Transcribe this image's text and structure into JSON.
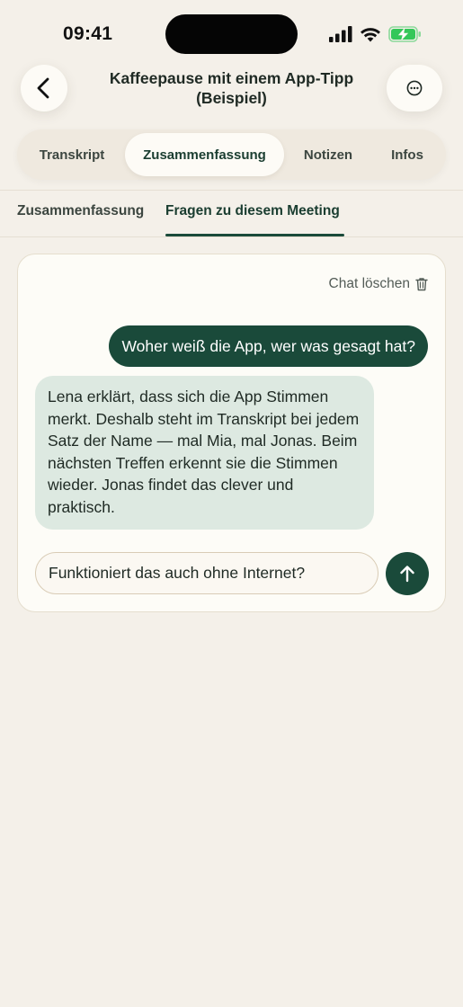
{
  "status_bar": {
    "time": "09:41"
  },
  "header": {
    "title": "Kaffeepause mit einem App-Tipp (Beispiel)"
  },
  "main_tabs": [
    {
      "label": "Transkript",
      "active": false
    },
    {
      "label": "Zusammenfassung",
      "active": true
    },
    {
      "label": "Notizen",
      "active": false
    },
    {
      "label": "Infos",
      "active": false
    }
  ],
  "sub_tabs": [
    {
      "label": "Zusammenfassung",
      "active": false
    },
    {
      "label": "Fragen zu diesem Meeting",
      "active": true
    }
  ],
  "chat": {
    "clear_label": "Chat löschen",
    "messages": [
      {
        "role": "user",
        "text": "Woher weiß die App, wer was gesagt hat?"
      },
      {
        "role": "assistant",
        "text": "Lena erklärt, dass sich die App Stimmen merkt. Deshalb steht im Transkript bei jedem Satz der Name — mal Mia, mal Jonas. Beim nächsten Treffen erkennt sie die Stimmen wieder. Jonas findet das clever und praktisch."
      }
    ],
    "input_value": "Funktioniert das auch ohne Internet?"
  },
  "icons": {
    "back": "chevron-left-icon",
    "more": "ellipsis-circle-icon",
    "trash": "trash-icon",
    "send": "arrow-up-icon",
    "signal": "cellular-signal-icon",
    "wifi": "wifi-icon",
    "battery": "battery-charging-icon"
  },
  "colors": {
    "background": "#f4f0e9",
    "accent": "#1a4a3a",
    "bot_bubble": "#dde9e1",
    "card": "#fdfcf7",
    "battery": "#34c759"
  }
}
